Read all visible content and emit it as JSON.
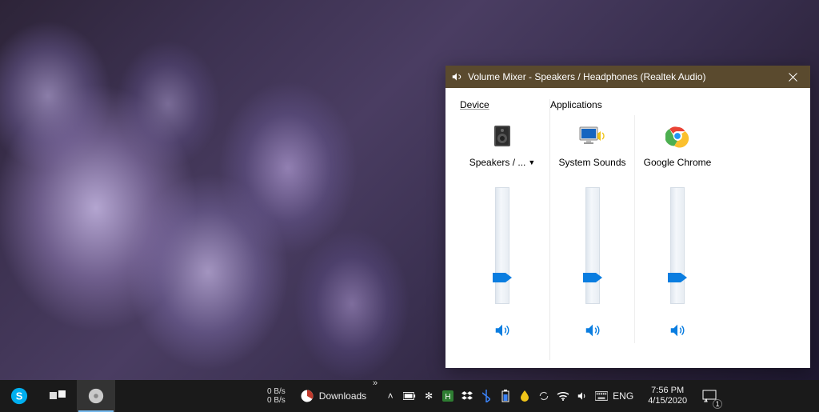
{
  "window": {
    "title": "Volume Mixer - Speakers / Headphones (Realtek Audio)"
  },
  "sections": {
    "device_heading": "Device",
    "apps_heading": "Applications"
  },
  "channels": {
    "device": {
      "label": "Speakers / ...",
      "level": 18
    },
    "system_sounds": {
      "label": "System Sounds",
      "level": 18
    },
    "chrome": {
      "label": "Google Chrome",
      "level": 18
    }
  },
  "taskbar": {
    "net_up": "0 B/s",
    "net_down": "0 B/s",
    "downloads": "Downloads",
    "lang": "ENG",
    "time": "7:56 PM",
    "date": "4/15/2020",
    "action_count": "1"
  }
}
